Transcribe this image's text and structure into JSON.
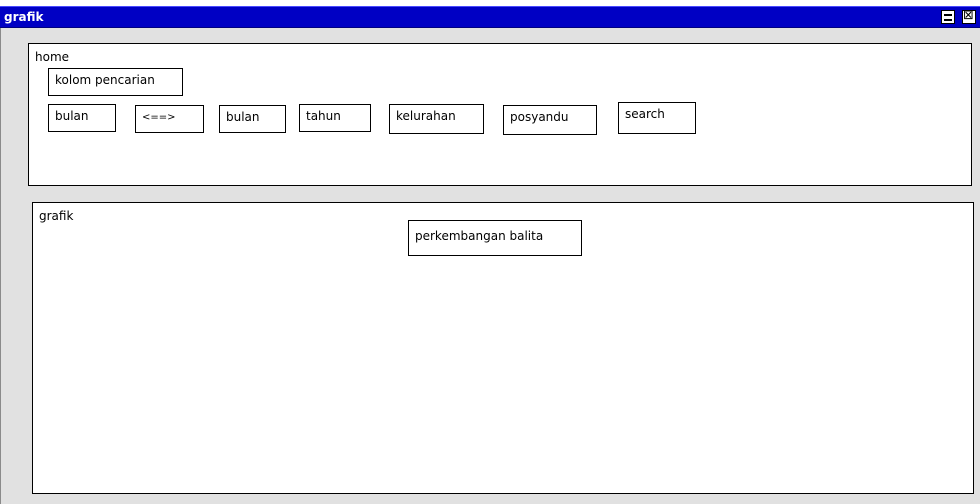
{
  "window": {
    "title": "grafik"
  },
  "home": {
    "label": "home",
    "search_label": "kolom pencarian",
    "fields": [
      "bulan",
      "<==>",
      "bulan",
      "tahun",
      "kelurahan",
      "posyandu"
    ],
    "search_button": "search"
  },
  "grafik": {
    "label": "grafik",
    "chart_title": "perkembangan balita"
  }
}
